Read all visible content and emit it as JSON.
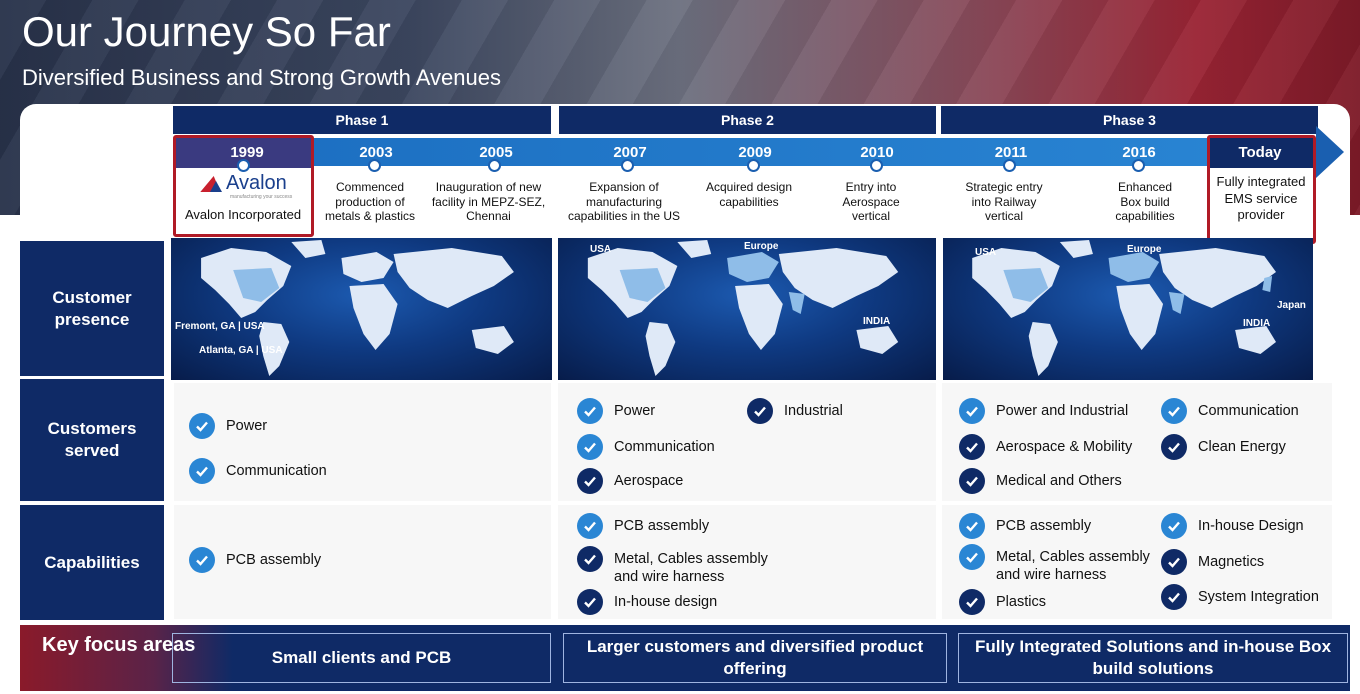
{
  "header": {
    "title": "Our Journey So Far",
    "subtitle": "Diversified Business and Strong Growth Avenues"
  },
  "phases": [
    "Phase 1",
    "Phase 2",
    "Phase 3"
  ],
  "timeline": [
    {
      "year": "1999",
      "text": "Avalon Incorporated"
    },
    {
      "year": "2003",
      "text": "Commenced production of metals & plastics"
    },
    {
      "year": "2005",
      "text": "Inauguration of new facility in MEPZ-SEZ, Chennai"
    },
    {
      "year": "2007",
      "text": "Expansion of manufacturing capabilities in the US"
    },
    {
      "year": "2009",
      "text": "Acquired design capabilities"
    },
    {
      "year": "2010",
      "text": "Entry into Aerospace vertical"
    },
    {
      "year": "2011",
      "text": "Strategic entry into Railway vertical"
    },
    {
      "year": "2016",
      "text": "Enhanced Box build capabilities"
    },
    {
      "year": "Today",
      "text": "Fully integrated EMS service provider"
    }
  ],
  "logo": {
    "text": "Avalon",
    "tagline": "manufacturing your success"
  },
  "row_labels": {
    "customer_presence": "Customer presence",
    "customers_served": "Customers served",
    "capabilities": "Capabilities"
  },
  "maps": {
    "phase1": {
      "labels": [
        "Fremont, GA | USA",
        "Atlanta, GA | USA"
      ]
    },
    "phase2": {
      "labels": [
        "USA",
        "Europe",
        "INDIA"
      ]
    },
    "phase3": {
      "labels": [
        "USA",
        "Europe",
        "Japan",
        "INDIA"
      ]
    }
  },
  "customers_served": {
    "phase1": [
      "Power",
      "Communication"
    ],
    "phase2": [
      "Power",
      "Industrial",
      "Communication",
      "Aerospace"
    ],
    "phase3": [
      "Power and Industrial",
      "Communication",
      "Aerospace & Mobility",
      "Clean Energy",
      "Medical and Others"
    ]
  },
  "capabilities": {
    "phase1": [
      "PCB assembly"
    ],
    "phase2": [
      "PCB assembly",
      "Metal, Cables assembly and wire harness",
      "In-house design"
    ],
    "phase3": [
      "PCB assembly",
      "In-house Design",
      "Metal, Cables assembly and wire harness",
      "Magnetics",
      "Plastics",
      "System Integration"
    ]
  },
  "key_focus": {
    "label": "Key focus areas",
    "boxes": [
      "Small clients and PCB",
      "Larger customers and diversified product offering",
      "Fully Integrated Solutions and in-house Box build solutions"
    ]
  },
  "colors": {
    "navy": "#0f2a66",
    "blue": "#2a86d4",
    "highlight_red": "#b01a26"
  }
}
